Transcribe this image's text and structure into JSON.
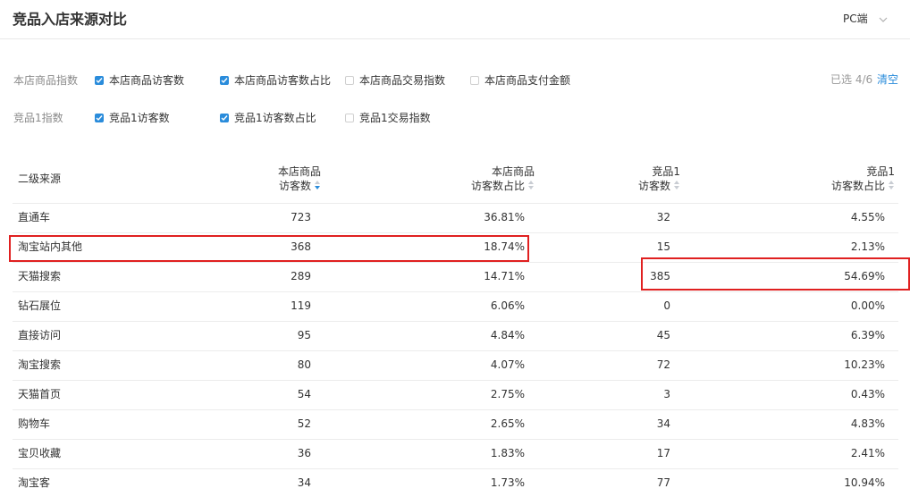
{
  "header": {
    "title": "竞品入店来源对比",
    "device_select": "PC端"
  },
  "filters": {
    "row1": {
      "label": "本店商品指数",
      "options": [
        {
          "label": "本店商品访客数",
          "checked": true
        },
        {
          "label": "本店商品访客数占比",
          "checked": true
        },
        {
          "label": "本店商品交易指数",
          "checked": false
        },
        {
          "label": "本店商品支付金额",
          "checked": false
        }
      ]
    },
    "row2": {
      "label": "竞品1指数",
      "options": [
        {
          "label": "竞品1访客数",
          "checked": true
        },
        {
          "label": "竞品1访客数占比",
          "checked": true
        },
        {
          "label": "竞品1交易指数",
          "checked": false
        }
      ]
    },
    "selected_count": "已选 4/6",
    "clear_label": "清空"
  },
  "table": {
    "columns": [
      {
        "line1": "二级来源",
        "line2": ""
      },
      {
        "line1": "本店商品",
        "line2": "访客数"
      },
      {
        "line1": "本店商品",
        "line2": "访客数占比"
      },
      {
        "line1": "竞品1",
        "line2": "访客数"
      },
      {
        "line1": "竞品1",
        "line2": "访客数占比"
      }
    ],
    "rows": [
      [
        "直通车",
        "723",
        "36.81%",
        "32",
        "4.55%"
      ],
      [
        "淘宝站内其他",
        "368",
        "18.74%",
        "15",
        "2.13%"
      ],
      [
        "天猫搜索",
        "289",
        "14.71%",
        "385",
        "54.69%"
      ],
      [
        "钻石展位",
        "119",
        "6.06%",
        "0",
        "0.00%"
      ],
      [
        "直接访问",
        "95",
        "4.84%",
        "45",
        "6.39%"
      ],
      [
        "淘宝搜索",
        "80",
        "4.07%",
        "72",
        "10.23%"
      ],
      [
        "天猫首页",
        "54",
        "2.75%",
        "3",
        "0.43%"
      ],
      [
        "购物车",
        "52",
        "2.65%",
        "34",
        "4.83%"
      ],
      [
        "宝贝收藏",
        "36",
        "1.83%",
        "17",
        "2.41%"
      ],
      [
        "淘宝客",
        "34",
        "1.73%",
        "77",
        "10.94%"
      ]
    ]
  },
  "colors": {
    "accent": "#2a8cdb",
    "highlight": "#e02020"
  }
}
